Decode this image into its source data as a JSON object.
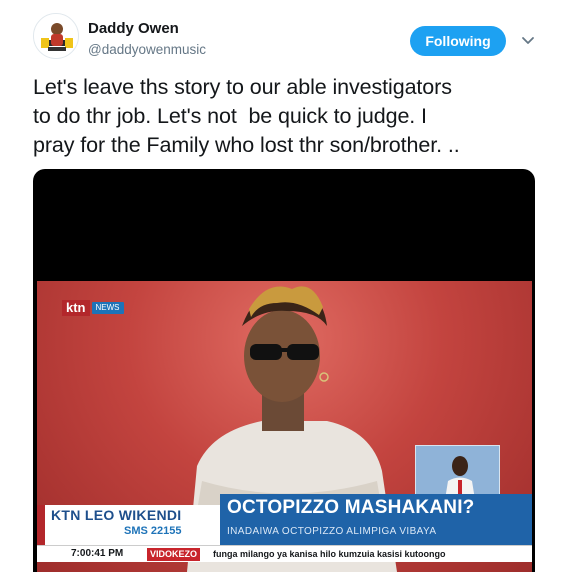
{
  "tweet": {
    "author_name": "Daddy Owen",
    "author_handle": "@daddyowenmusic",
    "follow_label": "Following",
    "text": "Let's leave ths story to our able investigators\nto do thr job. Let's not  be quick to judge. I\npray for the Family who lost thr son/brother. .."
  },
  "media": {
    "channel_logo": "ktn",
    "channel_logo_sub": "NEWS",
    "lower_third": {
      "brand": "KTN LEO WIKENDI",
      "sms": "SMS 22155",
      "headline": "OCTOPIZZO MASHAKANI?",
      "subheadline": "INADAIWA OCTOPIZZO ALIMPIGA VIBAYA"
    },
    "ticker": {
      "time": "7:00:41 PM",
      "tag": "VIDOKEZO",
      "text": "funga milango ya kanisa hilo kumzuia kasisi kutoongo"
    }
  },
  "colors": {
    "accent": "#1da1f2",
    "text": "#14171a",
    "secondary_text": "#657786",
    "ktn_red": "#b3272b",
    "ktn_blue": "#1f63a8"
  },
  "icons": {
    "caret": "chevron-down-icon",
    "avatar": "avatar"
  }
}
